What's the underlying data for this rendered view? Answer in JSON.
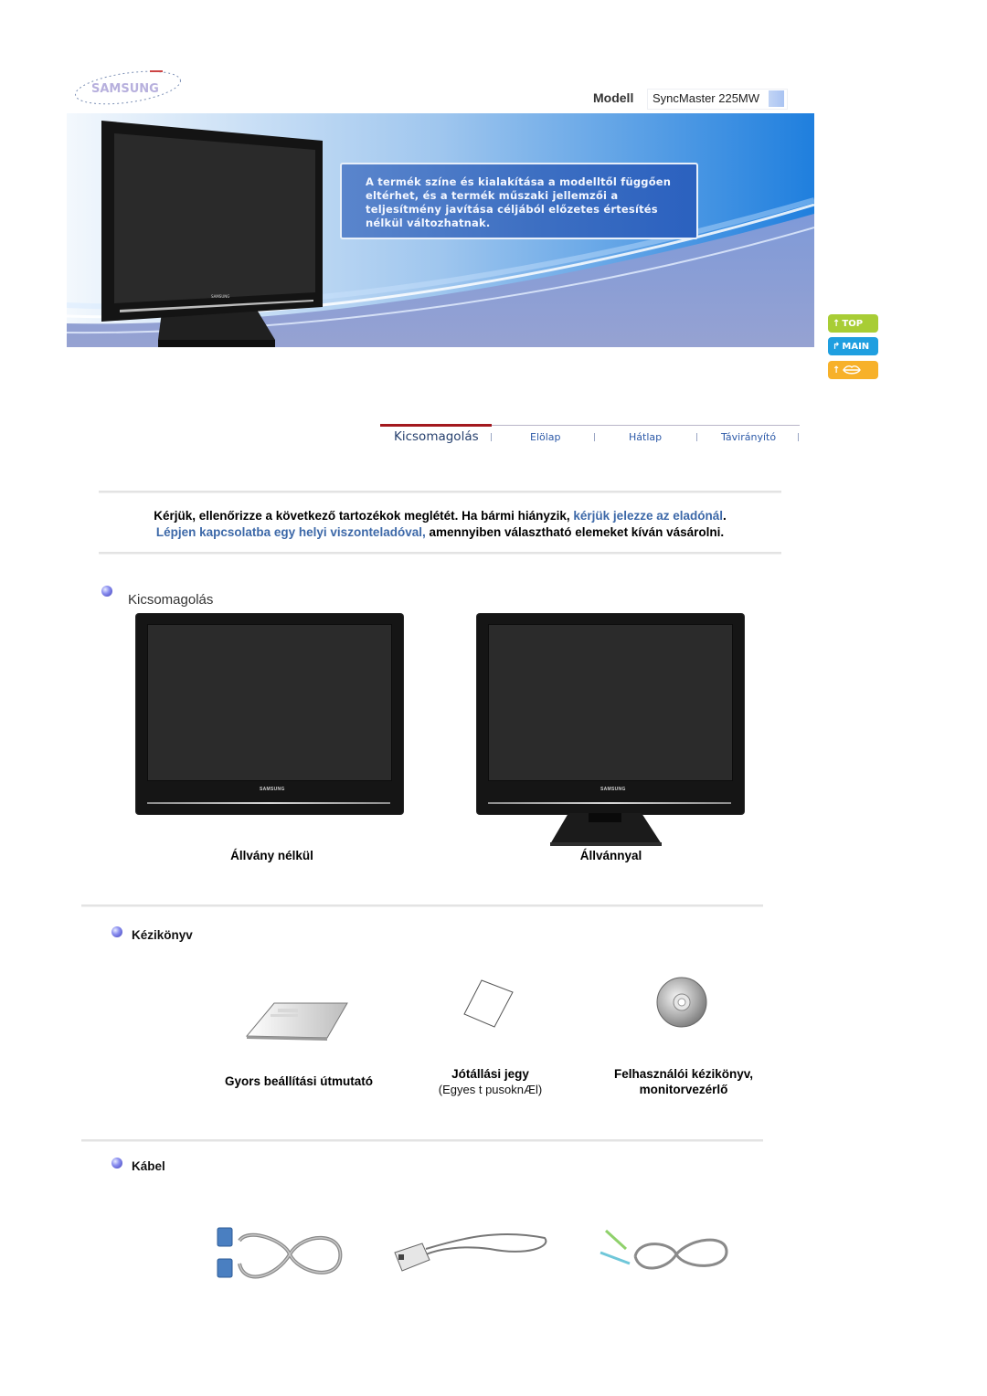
{
  "header": {
    "logo_alt": "SAMSUNG",
    "model_label": "Modell",
    "model_value": "SyncMaster 225MW"
  },
  "banner": {
    "notice": "A termék színe és kialakítása a modelltől függően eltérhet, és a termék műszaki jellemzői a teljesítmény javítása céljából előzetes értesítés nélkül változhatnak."
  },
  "side_nav": {
    "top": "TOP",
    "main": "MAIN",
    "up_icon": "lips-icon"
  },
  "tabs": [
    {
      "label": "Kicsomagolás",
      "active": true
    },
    {
      "label": "Elölap",
      "active": false
    },
    {
      "label": "Hátlap",
      "active": false
    },
    {
      "label": "Távirányító",
      "active": false
    }
  ],
  "intro": {
    "line1_text": "Kérjük, ellenőrizze a következő tartozékok meglétét. Ha bármi hiányzik, ",
    "line1_link": "kérjük jelezze az eladónál",
    "line1_end": ".",
    "line2_link": "Lépjen kapcsolatba egy helyi viszonteladóval,",
    "line2_text": " amennyiben választható elemeket kíván vásárolni."
  },
  "sections": {
    "unpacking": {
      "title": "Kicsomagolás",
      "items": [
        {
          "caption": "Állvány nélkül",
          "brand": "SAMSUNG"
        },
        {
          "caption": "Állvánnyal",
          "brand": "SAMSUNG"
        }
      ]
    },
    "manual": {
      "title": "Kézikönyv",
      "items": [
        {
          "caption": "Gyors beállítási útmutató",
          "sub": ""
        },
        {
          "caption": "Jótállási jegy",
          "sub": "(Egyes t pusoknÆl)"
        },
        {
          "caption": "Felhasználói kézikönyv,",
          "caption2": "monitorvezérlő"
        }
      ]
    },
    "cable": {
      "title": "Kábel",
      "items": [
        {
          "name": "d-sub-cable"
        },
        {
          "name": "power-cord"
        },
        {
          "name": "audio-cable"
        }
      ]
    }
  },
  "colors": {
    "link": "#3c68a8",
    "tab_active_bar": "#a3181e",
    "top_btn": "#a8cd35",
    "main_btn": "#1f9fe0",
    "up_btn": "#f7b12a"
  }
}
